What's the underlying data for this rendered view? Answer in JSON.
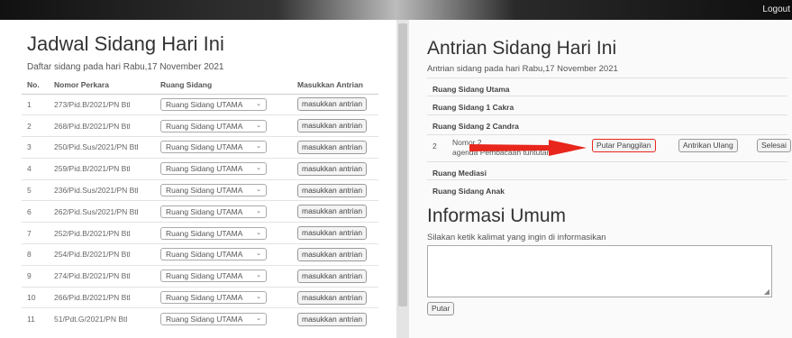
{
  "topbar": {
    "logout": "Logout"
  },
  "left": {
    "title": "Jadwal Sidang Hari Ini",
    "subtitle": "Daftar sidang pada hari Rabu,17 November 2021",
    "columns": {
      "no": "No.",
      "nomor": "Nomor Perkara",
      "ruang": "Ruang Sidang",
      "antrian": "Masukkan Antrian"
    },
    "select_value": "Ruang Sidang UTAMA",
    "button_label": "masukkan antrian",
    "rows": [
      {
        "no": "1",
        "nomor": "273/Pid.B/2021/PN Btl"
      },
      {
        "no": "2",
        "nomor": "268/Pid.B/2021/PN Btl"
      },
      {
        "no": "3",
        "nomor": "250/Pid.Sus/2021/PN Btl"
      },
      {
        "no": "4",
        "nomor": "259/Pid.B/2021/PN Btl"
      },
      {
        "no": "5",
        "nomor": "236/Pid.Sus/2021/PN Btl"
      },
      {
        "no": "6",
        "nomor": "262/Pid.Sus/2021/PN Btl"
      },
      {
        "no": "7",
        "nomor": "252/Pid.B/2021/PN Btl"
      },
      {
        "no": "8",
        "nomor": "254/Pid.B/2021/PN Btl"
      },
      {
        "no": "9",
        "nomor": "274/Pid.B/2021/PN Btl"
      },
      {
        "no": "10",
        "nomor": "266/Pid.B/2021/PN Btl"
      },
      {
        "no": "11",
        "nomor": "51/Pdt.G/2021/PN Btl"
      }
    ]
  },
  "right": {
    "title": "Antrian Sidang Hari Ini",
    "subtitle": "Antrian sidang pada hari Rabu,17 November 2021",
    "rooms": {
      "utama": "Ruang Sidang Utama",
      "cakra": "Ruang Sidang 1 Cakra",
      "candra": "Ruang Sidang 2 Candra",
      "mediasi": "Ruang Mediasi",
      "anak": "Ruang Sidang Anak"
    },
    "queue_item": {
      "number": "2",
      "line1": "Nomor 2",
      "line2": "agenda Pembacaan tuntutan",
      "play": "Putar Panggilan",
      "requeue": "Antrikan Ulang",
      "done": "Selesai"
    },
    "info": {
      "title": "Informasi Umum",
      "subtitle": "Silakan ketik kalimat yang ingin di informasikan",
      "textarea_value": "",
      "play_button": "Putar"
    },
    "arrow_color": "#e8261c"
  }
}
